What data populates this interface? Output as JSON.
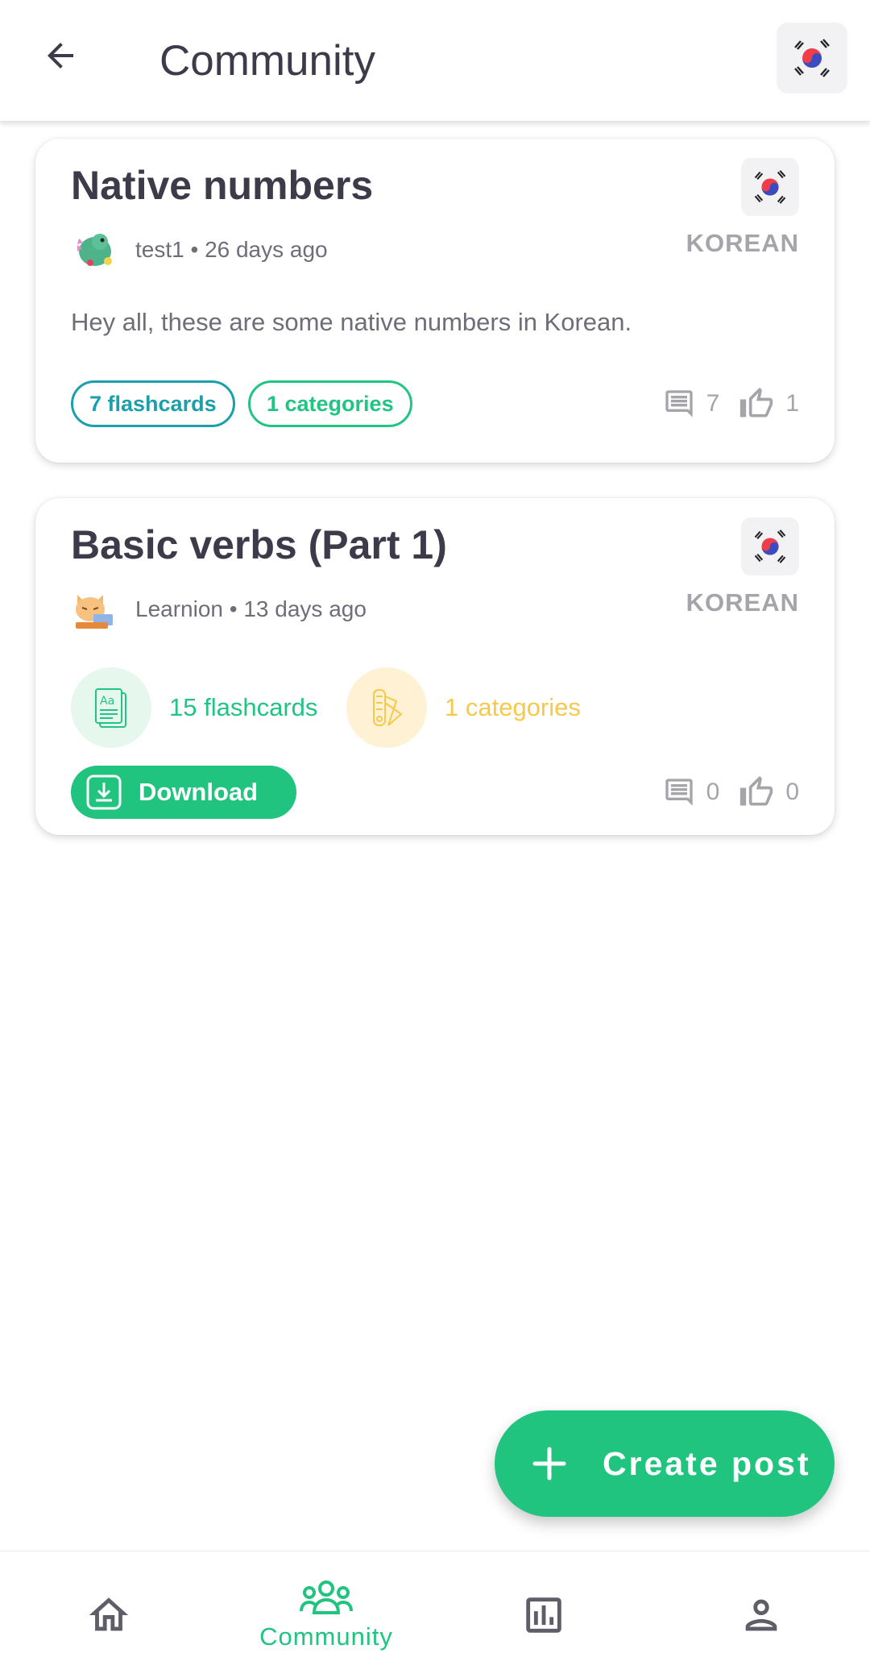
{
  "appbar": {
    "title": "Community",
    "back_icon": "arrow-left-icon",
    "flag_icon": "korea-flag-icon"
  },
  "posts": [
    {
      "title": "Native numbers",
      "language": "KOREAN",
      "author": "test1",
      "time": "26 days ago",
      "author_line": "test1 • 26 days ago",
      "description": "Hey all, these are some native numbers in Korean.",
      "flashcards_label": "7 flashcards",
      "categories_label": "1 categories",
      "comments": "7",
      "likes": "1"
    },
    {
      "title": "Basic verbs (Part 1)",
      "language": "KOREAN",
      "author": "Learnion",
      "time": "13 days ago",
      "author_line": "Learnion • 13 days ago",
      "flashcards_label": "15 flashcards",
      "categories_label": "1 categories",
      "download_label": "Download",
      "comments": "0",
      "likes": "0"
    }
  ],
  "fab": {
    "label": "Create post"
  },
  "bottom_nav": {
    "items": [
      {
        "icon": "home-icon",
        "label": ""
      },
      {
        "icon": "community-icon",
        "label": "Community",
        "active": true
      },
      {
        "icon": "stats-icon",
        "label": ""
      },
      {
        "icon": "profile-icon",
        "label": ""
      }
    ]
  },
  "colors": {
    "accent": "#20c47f",
    "teal": "#1a9fab",
    "yellow": "#f8c849",
    "text_dark": "#3d3b4a",
    "text_muted": "#6f6d78",
    "text_light": "#a5a4ab"
  }
}
